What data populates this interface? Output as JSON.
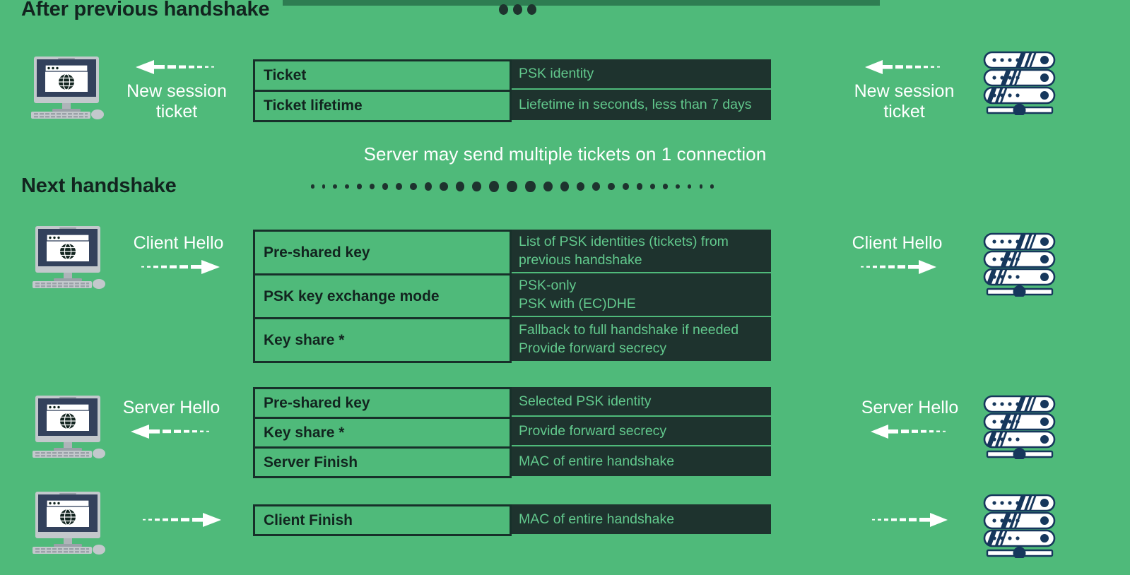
{
  "banner": {
    "text": "",
    "dots": [
      "dot",
      "dot",
      "dot"
    ]
  },
  "headings": {
    "after_previous": "After previous handshake",
    "next": "Next handshake"
  },
  "note": {
    "text": "Server may send multiple tickets on 1 connection"
  },
  "rows": [
    {
      "id": "new-session-ticket",
      "client_label": "New session\nticket",
      "client_label_line1": "New session",
      "client_label_line2": "ticket",
      "server_label_line1": "New session",
      "server_label_line2": "ticket",
      "direction": "left",
      "table": [
        {
          "field": "Ticket",
          "values": [
            "PSK identity"
          ]
        },
        {
          "field": "Ticket lifetime",
          "values": [
            "Liefetime in seconds, less than 7 days"
          ]
        }
      ]
    },
    {
      "id": "client-hello",
      "client_label_line1": "Client Hello",
      "client_label_line2": "",
      "server_label_line1": "Client Hello",
      "server_label_line2": "",
      "direction": "right",
      "table": [
        {
          "field": "Pre-shared key",
          "values": [
            "List of PSK identities (tickets) from",
            "previous handshake"
          ]
        },
        {
          "field": "PSK key exchange mode",
          "values": [
            "PSK-only",
            "PSK with (EC)DHE"
          ]
        },
        {
          "field": "Key share *",
          "values": [
            "Fallback to full handshake if needed",
            "Provide forward secrecy"
          ]
        }
      ]
    },
    {
      "id": "server-hello",
      "client_label_line1": "Server Hello",
      "client_label_line2": "",
      "server_label_line1": "Server Hello",
      "server_label_line2": "",
      "direction": "left",
      "table": [
        {
          "field": "Pre-shared key",
          "values": [
            "Selected PSK identity"
          ]
        },
        {
          "field": "Key share *",
          "values": [
            "Provide forward secrecy"
          ]
        },
        {
          "field": "Server Finish",
          "values": [
            "MAC of entire handshake"
          ]
        }
      ]
    },
    {
      "id": "client-finish",
      "client_label_line1": "",
      "client_label_line2": "",
      "server_label_line1": "",
      "server_label_line2": "",
      "direction": "right",
      "table": [
        {
          "field": "Client Finish",
          "values": [
            "MAC of entire handshake"
          ]
        }
      ]
    }
  ],
  "tables": {
    "ticket": {
      "r0": {
        "field": "Ticket",
        "v0": "PSK identity"
      },
      "r1": {
        "field": "Ticket lifetime",
        "v0": "Liefetime in seconds, less than 7 days"
      }
    },
    "client_hello": {
      "r0": {
        "field": "Pre-shared key",
        "v0": "List of PSK identities (tickets) from",
        "v1": "previous handshake"
      },
      "r1": {
        "field": "PSK key exchange mode",
        "v0": "PSK-only",
        "v1": "PSK with (EC)DHE"
      },
      "r2": {
        "field": "Key share *",
        "v0": "Fallback to full handshake if needed",
        "v1": "Provide forward secrecy"
      }
    },
    "server_hello": {
      "r0": {
        "field": "Pre-shared key",
        "v0": "Selected PSK identity"
      },
      "r1": {
        "field": "Key share *",
        "v0": "Provide forward secrecy"
      },
      "r2": {
        "field": "Server Finish",
        "v0": "MAC of entire handshake"
      }
    },
    "client_finish": {
      "r0": {
        "field": "Client Finish",
        "v0": "MAC of entire handshake"
      }
    }
  },
  "labels": {
    "new_session_ticket_l1": "New session",
    "new_session_ticket_l2": "ticket",
    "client_hello": "Client Hello",
    "server_hello": "Server Hello"
  },
  "icons": {
    "client": "desktop-computer-browser-globe-icon",
    "server": "server-rack-icon",
    "arrow_left": "arrow-left-dashed-icon",
    "arrow_right": "arrow-right-dashed-icon"
  },
  "colors": {
    "background_green": "#4FBA7A",
    "banner_green": "#2E7D52",
    "dark_cell": "#1E332E",
    "dark_text": "#12241F",
    "cell_value_green": "#62C98D",
    "white": "#FFFFFF",
    "monitor_navy": "#33415C",
    "monitor_gray": "#B9BFC4",
    "server_navy": "#16375C"
  }
}
